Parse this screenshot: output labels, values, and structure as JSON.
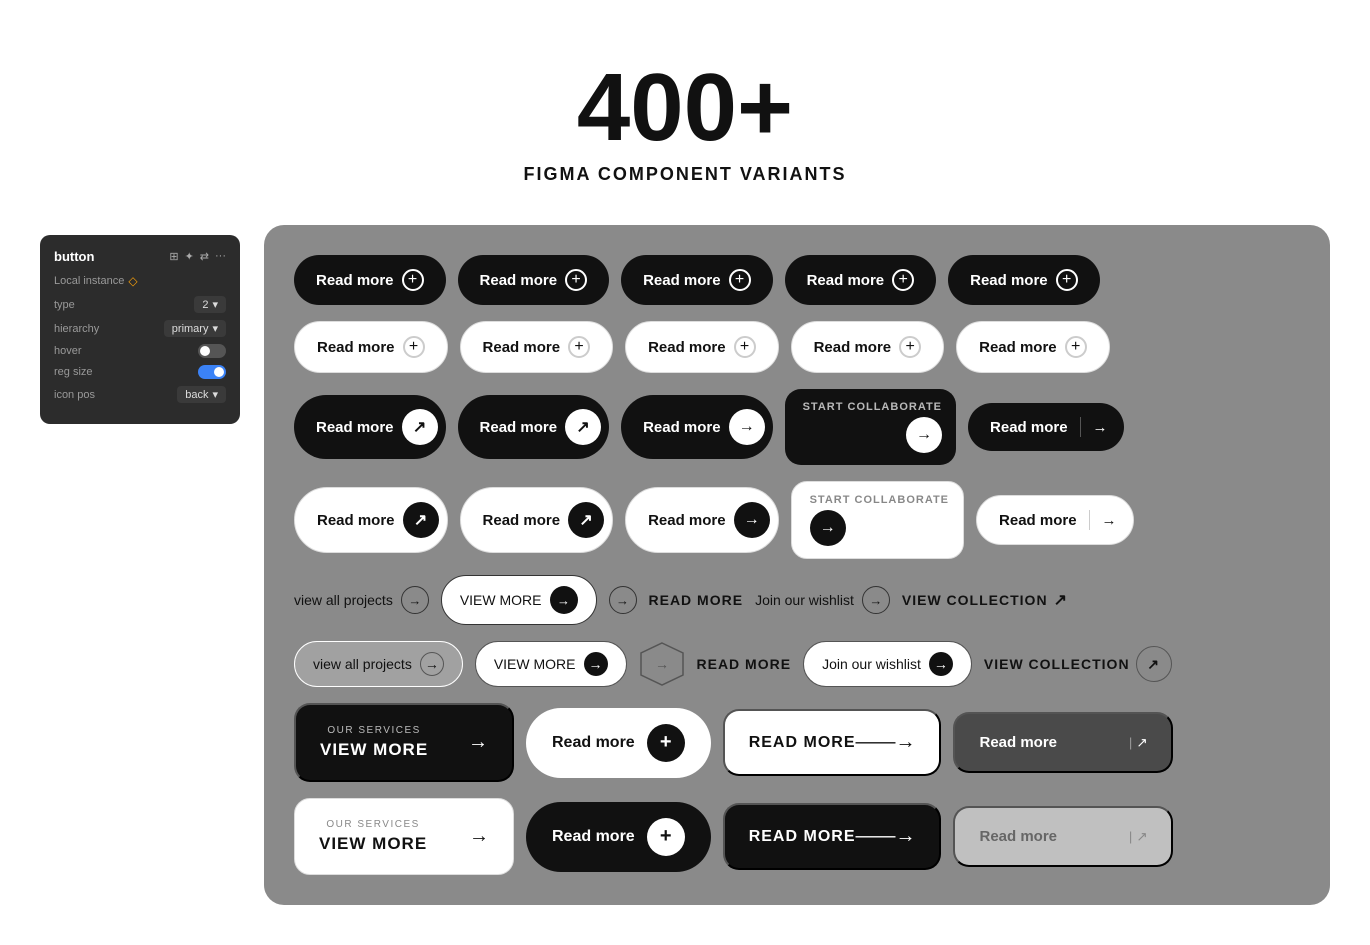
{
  "header": {
    "number": "400+",
    "subtitle": "FIGMA COMPONENT VARIANTS"
  },
  "panel": {
    "title": "button",
    "local_instance": "Local instance",
    "rows": [
      {
        "label": "type",
        "value": "2"
      },
      {
        "label": "hierarchy",
        "value": "primary"
      },
      {
        "label": "hover",
        "type": "toggle",
        "on": false
      },
      {
        "label": "reg size",
        "type": "toggle",
        "on": true
      },
      {
        "label": "icon pos",
        "value": "back"
      }
    ]
  },
  "buttons": {
    "read_more": "Read more",
    "start_collaborate": "Start collaborate",
    "view_more": "VIEW MORE",
    "read_more_upper": "READ MORE",
    "view_all_projects": "view all projects",
    "join_wishlist": "Join our wishlist",
    "view_collection": "VIEW COLLECTION",
    "our_services": "OUR SERVICES",
    "view_more_card": "VIEW MORE"
  }
}
